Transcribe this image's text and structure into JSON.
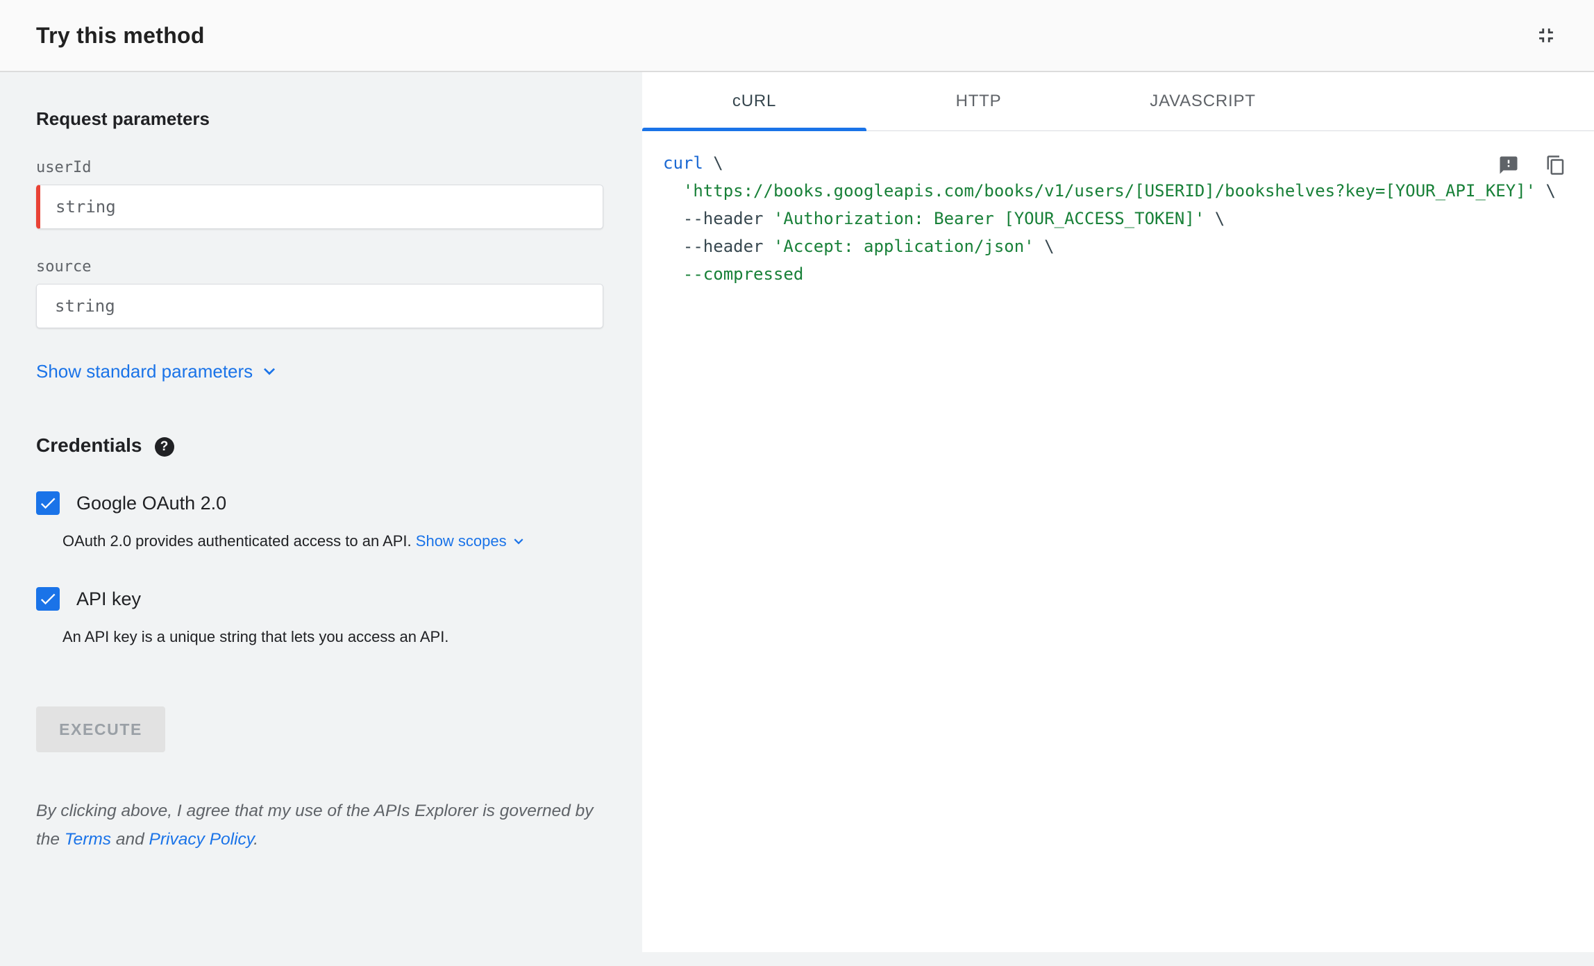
{
  "header": {
    "title": "Try this method"
  },
  "left": {
    "request_heading": "Request parameters",
    "fields": [
      {
        "label": "userId",
        "placeholder": "string",
        "required": true
      },
      {
        "label": "source",
        "placeholder": "string",
        "required": false
      }
    ],
    "show_standard_parameters": "Show standard parameters",
    "credentials_heading": "Credentials",
    "help_glyph": "?",
    "oauth": {
      "label": "Google OAuth 2.0",
      "description": "OAuth 2.0 provides authenticated access to an API.",
      "show_scopes": "Show scopes",
      "checked": true
    },
    "api_key": {
      "label": "API key",
      "description": "An API key is a unique string that lets you access an API.",
      "checked": true
    },
    "execute_label": "EXECUTE",
    "disclaimer": {
      "prefix": "By clicking above, I agree that my use of the APIs Explorer is governed by the ",
      "terms": "Terms",
      "middle": " and ",
      "privacy": "Privacy Policy",
      "suffix": "."
    }
  },
  "right": {
    "tabs": [
      {
        "label": "cURL",
        "active": true
      },
      {
        "label": "HTTP",
        "active": false
      },
      {
        "label": "JAVASCRIPT",
        "active": false
      }
    ],
    "code_lines": [
      {
        "tokens": [
          {
            "text": "curl",
            "type": "kw"
          },
          {
            "text": " \\",
            "type": "pln"
          }
        ]
      },
      {
        "tokens": [
          {
            "text": "  ",
            "type": "pln"
          },
          {
            "text": "'https://books.googleapis.com/books/v1/users/[USERID]/bookshelves?key=[YOUR_API_KEY]'",
            "type": "str"
          },
          {
            "text": " \\",
            "type": "pln"
          }
        ]
      },
      {
        "tokens": [
          {
            "text": "  --header ",
            "type": "pln"
          },
          {
            "text": "'Authorization: Bearer [YOUR_ACCESS_TOKEN]'",
            "type": "str"
          },
          {
            "text": " \\",
            "type": "pln"
          }
        ]
      },
      {
        "tokens": [
          {
            "text": "  --header ",
            "type": "pln"
          },
          {
            "text": "'Accept: application/json'",
            "type": "str"
          },
          {
            "text": " \\",
            "type": "pln"
          }
        ]
      },
      {
        "tokens": [
          {
            "text": "  --compressed",
            "type": "str"
          }
        ]
      }
    ]
  },
  "colors": {
    "accent_blue": "#1a73e8",
    "required_red": "#e94235",
    "code_keyword": "#1967d2",
    "code_string": "#188038",
    "code_plain": "#37474f"
  }
}
